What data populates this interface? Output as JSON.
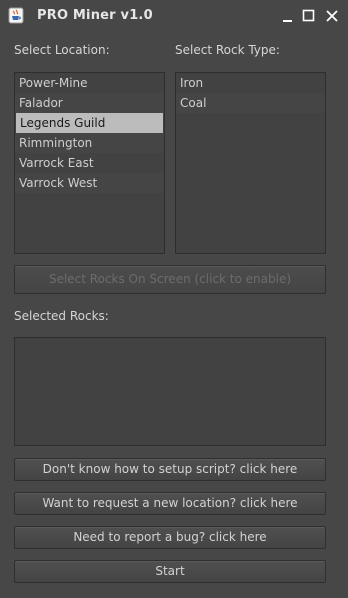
{
  "window": {
    "title": "PRO Miner v1.0",
    "icons": {
      "app": "java-cup-icon",
      "minimize": "minimize-icon",
      "maximize": "maximize-icon",
      "close": "close-icon"
    }
  },
  "location": {
    "label": "Select Location:",
    "items": [
      "Power-Mine",
      "Falador",
      "Legends Guild",
      "Rimmington",
      "Varrock East",
      "Varrock West"
    ],
    "selected": "Legends Guild"
  },
  "rock": {
    "label": "Select Rock Type:",
    "items": [
      "Iron",
      "Coal"
    ]
  },
  "select_rocks_button": {
    "label": "Select Rocks On Screen (click to enable)",
    "enabled": false
  },
  "selected_rocks": {
    "label": "Selected Rocks:",
    "value": ""
  },
  "buttons": {
    "setup_help": "Don't know how to setup script? click here",
    "request_location": "Want to request a new location? click here",
    "report_bug": "Need to report a bug? click here",
    "start": "Start"
  },
  "colors": {
    "background": "#474747",
    "selection": "#bcbcbc",
    "text": "#cfcfcf",
    "disabled_text": "#6c6c6c"
  }
}
